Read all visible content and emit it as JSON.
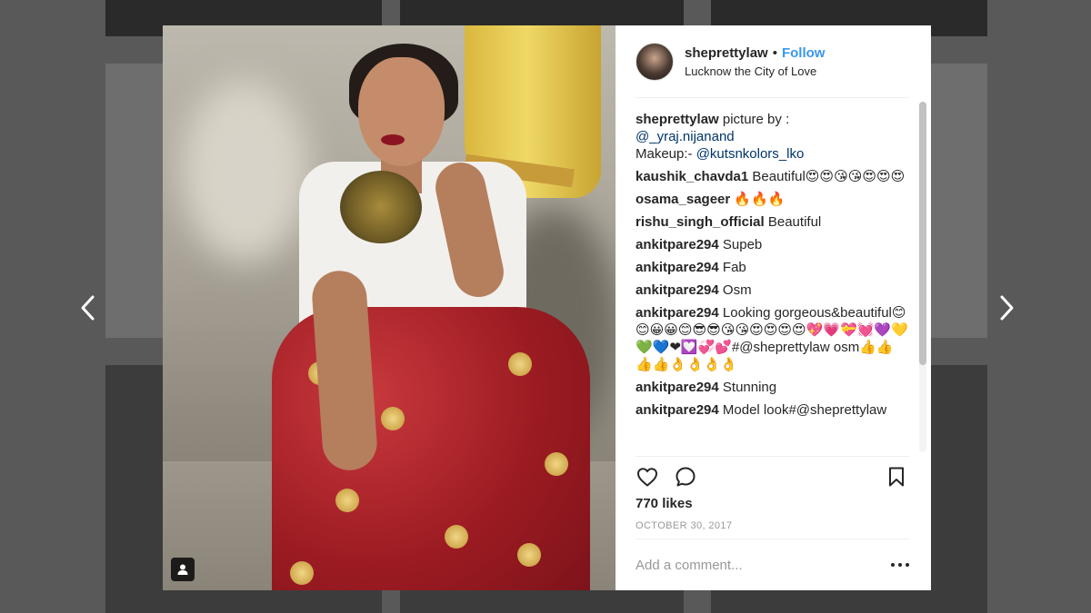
{
  "post": {
    "username": "sheprettylaw",
    "separator": "•",
    "follow_label": "Follow",
    "location": "Lucknow the City of Love"
  },
  "caption": {
    "username": "sheprettylaw",
    "text_1": " picture by :",
    "mention_1": "@_yraj.nijanand",
    "text_2": "Makeup:- ",
    "mention_2": "@kutsnkolors_lko"
  },
  "comments": [
    {
      "user": "kaushik_chavda1",
      "text": " Beautiful😍😍😘😘😍😍😍"
    },
    {
      "user": "osama_sageer",
      "text": " 🔥🔥🔥"
    },
    {
      "user": "rishu_singh_official",
      "text": " Beautiful"
    },
    {
      "user": "ankitpare294",
      "text": " Supeb"
    },
    {
      "user": "ankitpare294",
      "text": " Fab"
    },
    {
      "user": "ankitpare294",
      "text": " Osm"
    },
    {
      "user": "ankitpare294",
      "text": " Looking gorgeous&beautiful😊😊😀😀😊😎😎😘😘😍😍😍😍💖💗💝💓💜💛💚💙❤💟💞💕#@sheprettylaw osm👍👍👍👍👌👌👌👌"
    },
    {
      "user": "ankitpare294",
      "text": " Stunning"
    },
    {
      "user": "ankitpare294",
      "text": " Model look#@sheprettylaw"
    }
  ],
  "likes_label": "770 likes",
  "date": "OCTOBER 30, 2017",
  "comment_input": {
    "placeholder": "Add a comment..."
  },
  "icons": {
    "prev": "chevron-left-icon",
    "next": "chevron-right-icon",
    "like": "heart-icon",
    "comment": "comment-bubble-icon",
    "save": "bookmark-icon",
    "tag": "user-tag-icon",
    "more": "more-options-icon"
  },
  "colors": {
    "link": "#3897f0",
    "mention": "#003569",
    "text": "#262626",
    "muted": "#999999",
    "overlay": "#595959"
  }
}
